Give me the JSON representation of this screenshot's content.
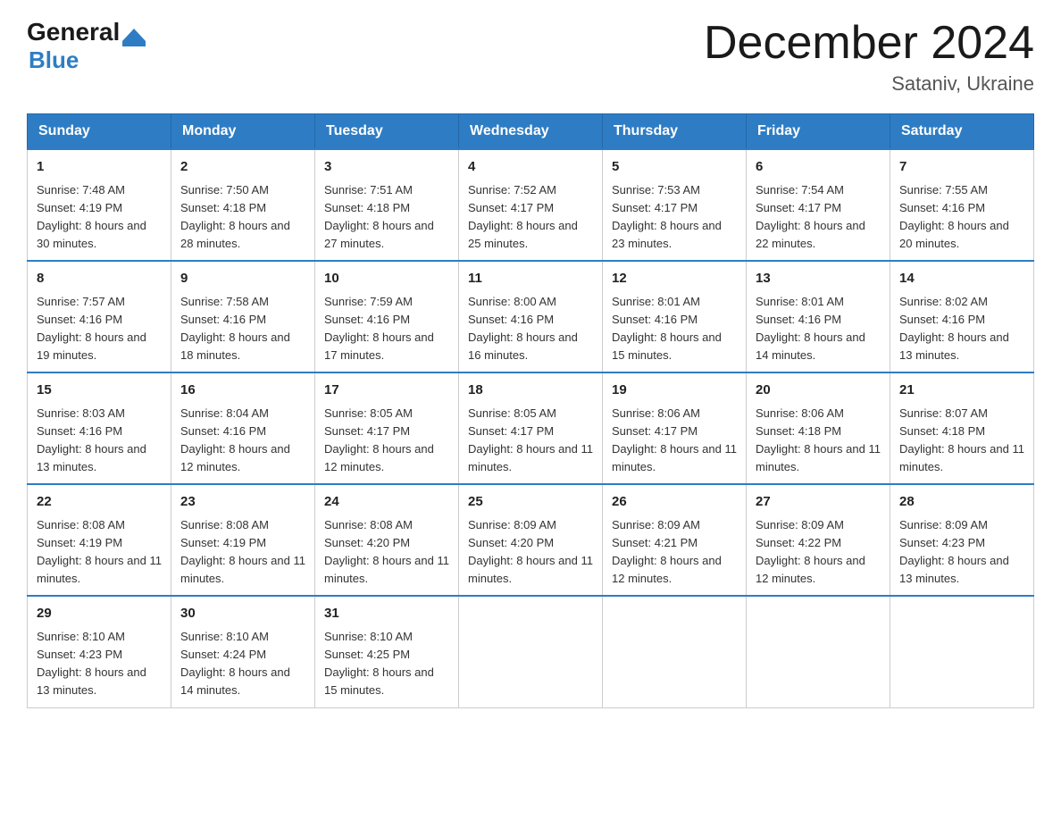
{
  "header": {
    "logo_general": "General",
    "logo_blue": "Blue",
    "month_title": "December 2024",
    "location": "Sataniv, Ukraine"
  },
  "weekdays": [
    "Sunday",
    "Monday",
    "Tuesday",
    "Wednesday",
    "Thursday",
    "Friday",
    "Saturday"
  ],
  "weeks": [
    [
      {
        "day": "1",
        "sunrise": "Sunrise: 7:48 AM",
        "sunset": "Sunset: 4:19 PM",
        "daylight": "Daylight: 8 hours and 30 minutes."
      },
      {
        "day": "2",
        "sunrise": "Sunrise: 7:50 AM",
        "sunset": "Sunset: 4:18 PM",
        "daylight": "Daylight: 8 hours and 28 minutes."
      },
      {
        "day": "3",
        "sunrise": "Sunrise: 7:51 AM",
        "sunset": "Sunset: 4:18 PM",
        "daylight": "Daylight: 8 hours and 27 minutes."
      },
      {
        "day": "4",
        "sunrise": "Sunrise: 7:52 AM",
        "sunset": "Sunset: 4:17 PM",
        "daylight": "Daylight: 8 hours and 25 minutes."
      },
      {
        "day": "5",
        "sunrise": "Sunrise: 7:53 AM",
        "sunset": "Sunset: 4:17 PM",
        "daylight": "Daylight: 8 hours and 23 minutes."
      },
      {
        "day": "6",
        "sunrise": "Sunrise: 7:54 AM",
        "sunset": "Sunset: 4:17 PM",
        "daylight": "Daylight: 8 hours and 22 minutes."
      },
      {
        "day": "7",
        "sunrise": "Sunrise: 7:55 AM",
        "sunset": "Sunset: 4:16 PM",
        "daylight": "Daylight: 8 hours and 20 minutes."
      }
    ],
    [
      {
        "day": "8",
        "sunrise": "Sunrise: 7:57 AM",
        "sunset": "Sunset: 4:16 PM",
        "daylight": "Daylight: 8 hours and 19 minutes."
      },
      {
        "day": "9",
        "sunrise": "Sunrise: 7:58 AM",
        "sunset": "Sunset: 4:16 PM",
        "daylight": "Daylight: 8 hours and 18 minutes."
      },
      {
        "day": "10",
        "sunrise": "Sunrise: 7:59 AM",
        "sunset": "Sunset: 4:16 PM",
        "daylight": "Daylight: 8 hours and 17 minutes."
      },
      {
        "day": "11",
        "sunrise": "Sunrise: 8:00 AM",
        "sunset": "Sunset: 4:16 PM",
        "daylight": "Daylight: 8 hours and 16 minutes."
      },
      {
        "day": "12",
        "sunrise": "Sunrise: 8:01 AM",
        "sunset": "Sunset: 4:16 PM",
        "daylight": "Daylight: 8 hours and 15 minutes."
      },
      {
        "day": "13",
        "sunrise": "Sunrise: 8:01 AM",
        "sunset": "Sunset: 4:16 PM",
        "daylight": "Daylight: 8 hours and 14 minutes."
      },
      {
        "day": "14",
        "sunrise": "Sunrise: 8:02 AM",
        "sunset": "Sunset: 4:16 PM",
        "daylight": "Daylight: 8 hours and 13 minutes."
      }
    ],
    [
      {
        "day": "15",
        "sunrise": "Sunrise: 8:03 AM",
        "sunset": "Sunset: 4:16 PM",
        "daylight": "Daylight: 8 hours and 13 minutes."
      },
      {
        "day": "16",
        "sunrise": "Sunrise: 8:04 AM",
        "sunset": "Sunset: 4:16 PM",
        "daylight": "Daylight: 8 hours and 12 minutes."
      },
      {
        "day": "17",
        "sunrise": "Sunrise: 8:05 AM",
        "sunset": "Sunset: 4:17 PM",
        "daylight": "Daylight: 8 hours and 12 minutes."
      },
      {
        "day": "18",
        "sunrise": "Sunrise: 8:05 AM",
        "sunset": "Sunset: 4:17 PM",
        "daylight": "Daylight: 8 hours and 11 minutes."
      },
      {
        "day": "19",
        "sunrise": "Sunrise: 8:06 AM",
        "sunset": "Sunset: 4:17 PM",
        "daylight": "Daylight: 8 hours and 11 minutes."
      },
      {
        "day": "20",
        "sunrise": "Sunrise: 8:06 AM",
        "sunset": "Sunset: 4:18 PM",
        "daylight": "Daylight: 8 hours and 11 minutes."
      },
      {
        "day": "21",
        "sunrise": "Sunrise: 8:07 AM",
        "sunset": "Sunset: 4:18 PM",
        "daylight": "Daylight: 8 hours and 11 minutes."
      }
    ],
    [
      {
        "day": "22",
        "sunrise": "Sunrise: 8:08 AM",
        "sunset": "Sunset: 4:19 PM",
        "daylight": "Daylight: 8 hours and 11 minutes."
      },
      {
        "day": "23",
        "sunrise": "Sunrise: 8:08 AM",
        "sunset": "Sunset: 4:19 PM",
        "daylight": "Daylight: 8 hours and 11 minutes."
      },
      {
        "day": "24",
        "sunrise": "Sunrise: 8:08 AM",
        "sunset": "Sunset: 4:20 PM",
        "daylight": "Daylight: 8 hours and 11 minutes."
      },
      {
        "day": "25",
        "sunrise": "Sunrise: 8:09 AM",
        "sunset": "Sunset: 4:20 PM",
        "daylight": "Daylight: 8 hours and 11 minutes."
      },
      {
        "day": "26",
        "sunrise": "Sunrise: 8:09 AM",
        "sunset": "Sunset: 4:21 PM",
        "daylight": "Daylight: 8 hours and 12 minutes."
      },
      {
        "day": "27",
        "sunrise": "Sunrise: 8:09 AM",
        "sunset": "Sunset: 4:22 PM",
        "daylight": "Daylight: 8 hours and 12 minutes."
      },
      {
        "day": "28",
        "sunrise": "Sunrise: 8:09 AM",
        "sunset": "Sunset: 4:23 PM",
        "daylight": "Daylight: 8 hours and 13 minutes."
      }
    ],
    [
      {
        "day": "29",
        "sunrise": "Sunrise: 8:10 AM",
        "sunset": "Sunset: 4:23 PM",
        "daylight": "Daylight: 8 hours and 13 minutes."
      },
      {
        "day": "30",
        "sunrise": "Sunrise: 8:10 AM",
        "sunset": "Sunset: 4:24 PM",
        "daylight": "Daylight: 8 hours and 14 minutes."
      },
      {
        "day": "31",
        "sunrise": "Sunrise: 8:10 AM",
        "sunset": "Sunset: 4:25 PM",
        "daylight": "Daylight: 8 hours and 15 minutes."
      },
      null,
      null,
      null,
      null
    ]
  ]
}
